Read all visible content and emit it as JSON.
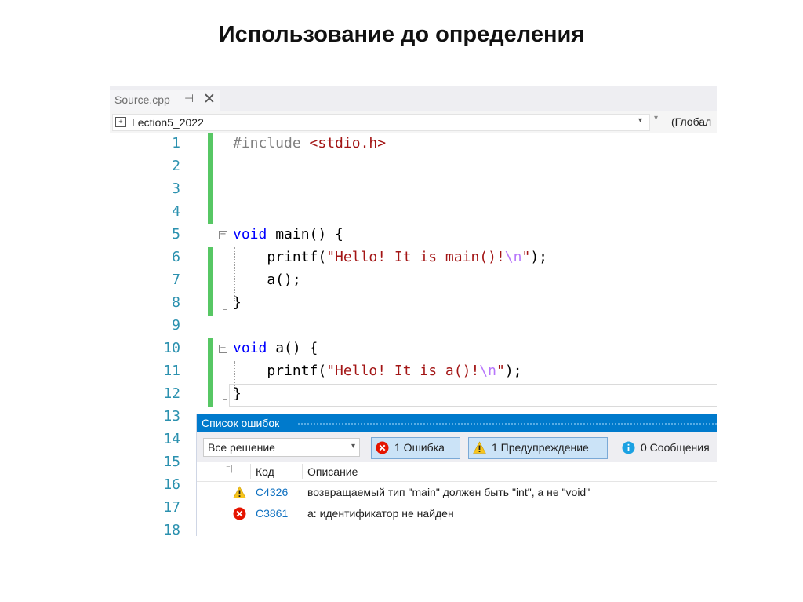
{
  "slide": {
    "title": "Использование до определения"
  },
  "tab": {
    "filename": "Source.cpp",
    "pin_glyph": "⊣",
    "close_glyph": "✕"
  },
  "navbar": {
    "project": "Lection5_2022",
    "scope": "(Глобал"
  },
  "code": {
    "lines": [
      {
        "num": "1",
        "tokens": [
          {
            "cls": "pp",
            "text": "#include "
          },
          {
            "cls": "inc",
            "text": "<stdio.h>"
          }
        ]
      },
      {
        "num": "2",
        "tokens": []
      },
      {
        "num": "3",
        "tokens": []
      },
      {
        "num": "4",
        "tokens": []
      },
      {
        "num": "5",
        "tokens": [
          {
            "cls": "kw",
            "text": "void"
          },
          {
            "cls": "pl",
            "text": " main() {"
          }
        ]
      },
      {
        "num": "6",
        "tokens": [
          {
            "cls": "pl",
            "text": "    printf("
          },
          {
            "cls": "str",
            "text": "\"Hello! It is main()!"
          },
          {
            "cls": "esc",
            "text": "\\n"
          },
          {
            "cls": "str",
            "text": "\""
          },
          {
            "cls": "pl",
            "text": ");"
          }
        ]
      },
      {
        "num": "7",
        "tokens": [
          {
            "cls": "pl",
            "text": "    a();"
          }
        ]
      },
      {
        "num": "8",
        "tokens": [
          {
            "cls": "pl",
            "text": "}"
          }
        ]
      },
      {
        "num": "9",
        "tokens": []
      },
      {
        "num": "10",
        "tokens": [
          {
            "cls": "kw",
            "text": "void"
          },
          {
            "cls": "pl",
            "text": " a() {"
          }
        ]
      },
      {
        "num": "11",
        "tokens": [
          {
            "cls": "pl",
            "text": "    printf("
          },
          {
            "cls": "str",
            "text": "\"Hello! It is a()!"
          },
          {
            "cls": "esc",
            "text": "\\n"
          },
          {
            "cls": "str",
            "text": "\""
          },
          {
            "cls": "pl",
            "text": ");"
          }
        ]
      },
      {
        "num": "12",
        "tokens": [
          {
            "cls": "pl",
            "text": "}"
          }
        ]
      },
      {
        "num": "13",
        "tokens": []
      },
      {
        "num": "14",
        "tokens": []
      },
      {
        "num": "15",
        "tokens": []
      },
      {
        "num": "16",
        "tokens": []
      },
      {
        "num": "17",
        "tokens": []
      },
      {
        "num": "18",
        "tokens": []
      }
    ]
  },
  "error_list": {
    "title": "Список ошибок",
    "scope": "Все решение",
    "filters": {
      "errors": "1 Ошибка",
      "warnings": "1 Предупреждение",
      "messages": "0 Сообщения"
    },
    "columns": {
      "code": "Код",
      "description": "Описание"
    },
    "rows": [
      {
        "severity": "warning",
        "code": "C4326",
        "description": "возвращаемый тип \"main\" должен быть \"int\", а не \"void\""
      },
      {
        "severity": "error",
        "code": "C3861",
        "description": "a: идентификатор не найден"
      }
    ]
  },
  "colors": {
    "line_numbers": "#2b91af",
    "keyword": "#0000ff",
    "string": "#a31515",
    "escape": "#b776fb",
    "change_bar": "#57c764",
    "panel_title": "#007acc",
    "error_code": "#0e70c0"
  }
}
